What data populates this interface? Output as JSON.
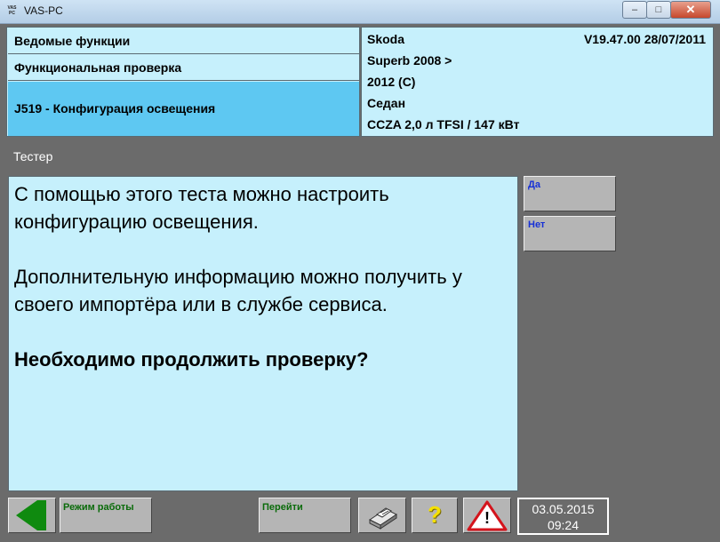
{
  "window": {
    "title": "VAS-PC",
    "icon_text": "VAS PC",
    "controls": {
      "minimize": "–",
      "maximize": "□",
      "close": "✕"
    }
  },
  "nav": {
    "items": [
      {
        "label": "Ведомые функции"
      },
      {
        "label": "Функциональная проверка"
      },
      {
        "label": "J519 - Конфигурация освещения",
        "selected": true
      }
    ]
  },
  "vehicle": {
    "make": "Skoda",
    "version": "V19.47.00 28/07/2011",
    "model": "Superb 2008 >",
    "year": "2012 (C)",
    "body": "Седан",
    "engine": "CCZA 2,0 л TFSI / 147 кВт"
  },
  "tester": {
    "label": "Тестер",
    "message_line1": "С помощью этого теста можно настроить конфигурацию освещения.",
    "message_line2": "Дополнительную информацию можно получить у своего импортёра или в службе сервиса.",
    "question": "Необходимо продолжить проверку?"
  },
  "side_buttons": {
    "yes": "Да",
    "no": "Нет"
  },
  "toolbar": {
    "mode": "Режим работы",
    "goto": "Перейти",
    "help": "?",
    "warning": "!"
  },
  "status": {
    "date": "03.05.2015",
    "time": "09:24"
  },
  "colors": {
    "panel_bg": "#c6f0fc",
    "selected_bg": "#5ec8f2",
    "frame_bg": "#6b6b6b",
    "button_label": "#1630d6",
    "toolbar_label": "#0a6b0a",
    "back_arrow": "#0f8a0f",
    "help_yellow": "#f5e000",
    "warning_red": "#d4141c"
  },
  "icons": [
    "app-icon",
    "back-arrow-icon",
    "printer-icon",
    "help-icon",
    "warning-icon"
  ]
}
